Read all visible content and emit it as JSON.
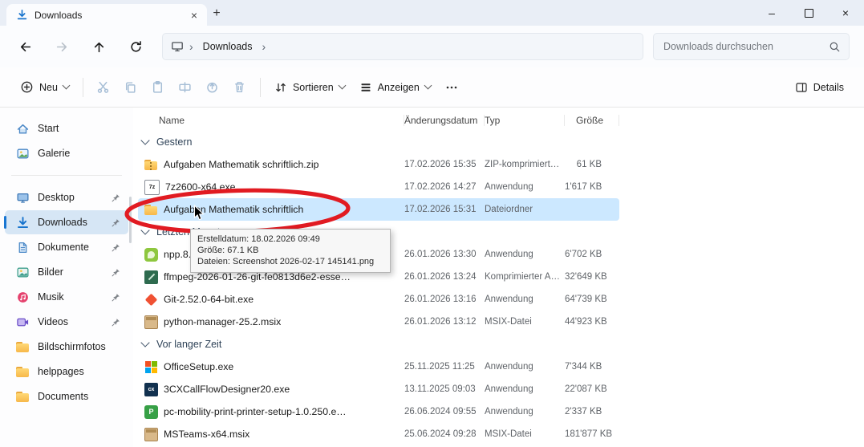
{
  "window": {
    "tab_title": "Downloads",
    "tab_close_glyph": "×",
    "new_tab_glyph": "+",
    "minimize_glyph": "–",
    "close_glyph": "×"
  },
  "navbar": {
    "breadcrumb": "Downloads",
    "chevron": "›",
    "search_placeholder": "Downloads durchsuchen"
  },
  "toolbar": {
    "new": "Neu",
    "sort": "Sortieren",
    "view": "Anzeigen",
    "details": "Details"
  },
  "sidebar": {
    "items": [
      {
        "label": "Start",
        "pinned": false
      },
      {
        "label": "Galerie",
        "pinned": false
      },
      {
        "label": "Desktop",
        "pinned": true
      },
      {
        "label": "Downloads",
        "pinned": true,
        "selected": true
      },
      {
        "label": "Dokumente",
        "pinned": true
      },
      {
        "label": "Bilder",
        "pinned": true
      },
      {
        "label": "Musik",
        "pinned": true
      },
      {
        "label": "Videos",
        "pinned": true
      },
      {
        "label": "Bildschirmfotos",
        "pinned": false
      },
      {
        "label": "helppages",
        "pinned": false
      },
      {
        "label": "Documents",
        "pinned": false
      }
    ]
  },
  "columns": {
    "name": "Name",
    "date": "Änderungsdatum",
    "type": "Typ",
    "size": "Größe"
  },
  "groups": [
    {
      "label": "Gestern"
    },
    {
      "label": "Letzten Monat"
    },
    {
      "label": "Vor langer Zeit"
    }
  ],
  "files": [
    {
      "name": "Aufgaben Mathematik schriftlich.zip",
      "date": "17.02.2026 15:35",
      "type": "ZIP-komprimierte…",
      "size": "61 KB"
    },
    {
      "name": "7z2600-x64.exe",
      "date": "17.02.2026 14:27",
      "type": "Anwendung",
      "size": "1'617 KB"
    },
    {
      "name": "Aufgaben Mathematik schriftlich",
      "date": "17.02.2026 15:31",
      "type": "Dateiordner",
      "size": ""
    },
    {
      "name": "npp.8.9.",
      "date": "26.01.2026 13:30",
      "type": "Anwendung",
      "size": "6'702 KB"
    },
    {
      "name": "ffmpeg-2026-01-26-git-fe0813d6e2-esse…",
      "date": "26.01.2026 13:24",
      "type": "Komprimierter Ar…",
      "size": "32'649 KB"
    },
    {
      "name": "Git-2.52.0-64-bit.exe",
      "date": "26.01.2026 13:16",
      "type": "Anwendung",
      "size": "64'739 KB"
    },
    {
      "name": "python-manager-25.2.msix",
      "date": "26.01.2026 13:12",
      "type": "MSIX-Datei",
      "size": "44'923 KB"
    },
    {
      "name": "OfficeSetup.exe",
      "date": "25.11.2025 11:25",
      "type": "Anwendung",
      "size": "7'344 KB"
    },
    {
      "name": "3CXCallFlowDesigner20.exe",
      "date": "13.11.2025 09:03",
      "type": "Anwendung",
      "size": "22'087 KB"
    },
    {
      "name": "pc-mobility-print-printer-setup-1.0.250.e…",
      "date": "26.06.2024 09:55",
      "type": "Anwendung",
      "size": "2'337 KB"
    },
    {
      "name": "MSTeams-x64.msix",
      "date": "25.06.2024 09:28",
      "type": "MSIX-Datei",
      "size": "181'877 KB"
    }
  ],
  "tooltip": {
    "line1": "Erstelldatum: 18.02.2026 09:49",
    "line2": "Größe: 67.1 KB",
    "line3": "Dateien: Screenshot 2026-02-17 145141.png"
  },
  "icon_labels": {
    "seven_zip": "7z",
    "three_cx": "cx",
    "papercut": "P"
  },
  "colors": {
    "accent_blue": "#1976d2",
    "row_selection": "#cce8ff",
    "sidebar_selection": "#d6e6f5",
    "annotation_red": "#e11b22",
    "titlebar_bg": "#e9eef6"
  }
}
